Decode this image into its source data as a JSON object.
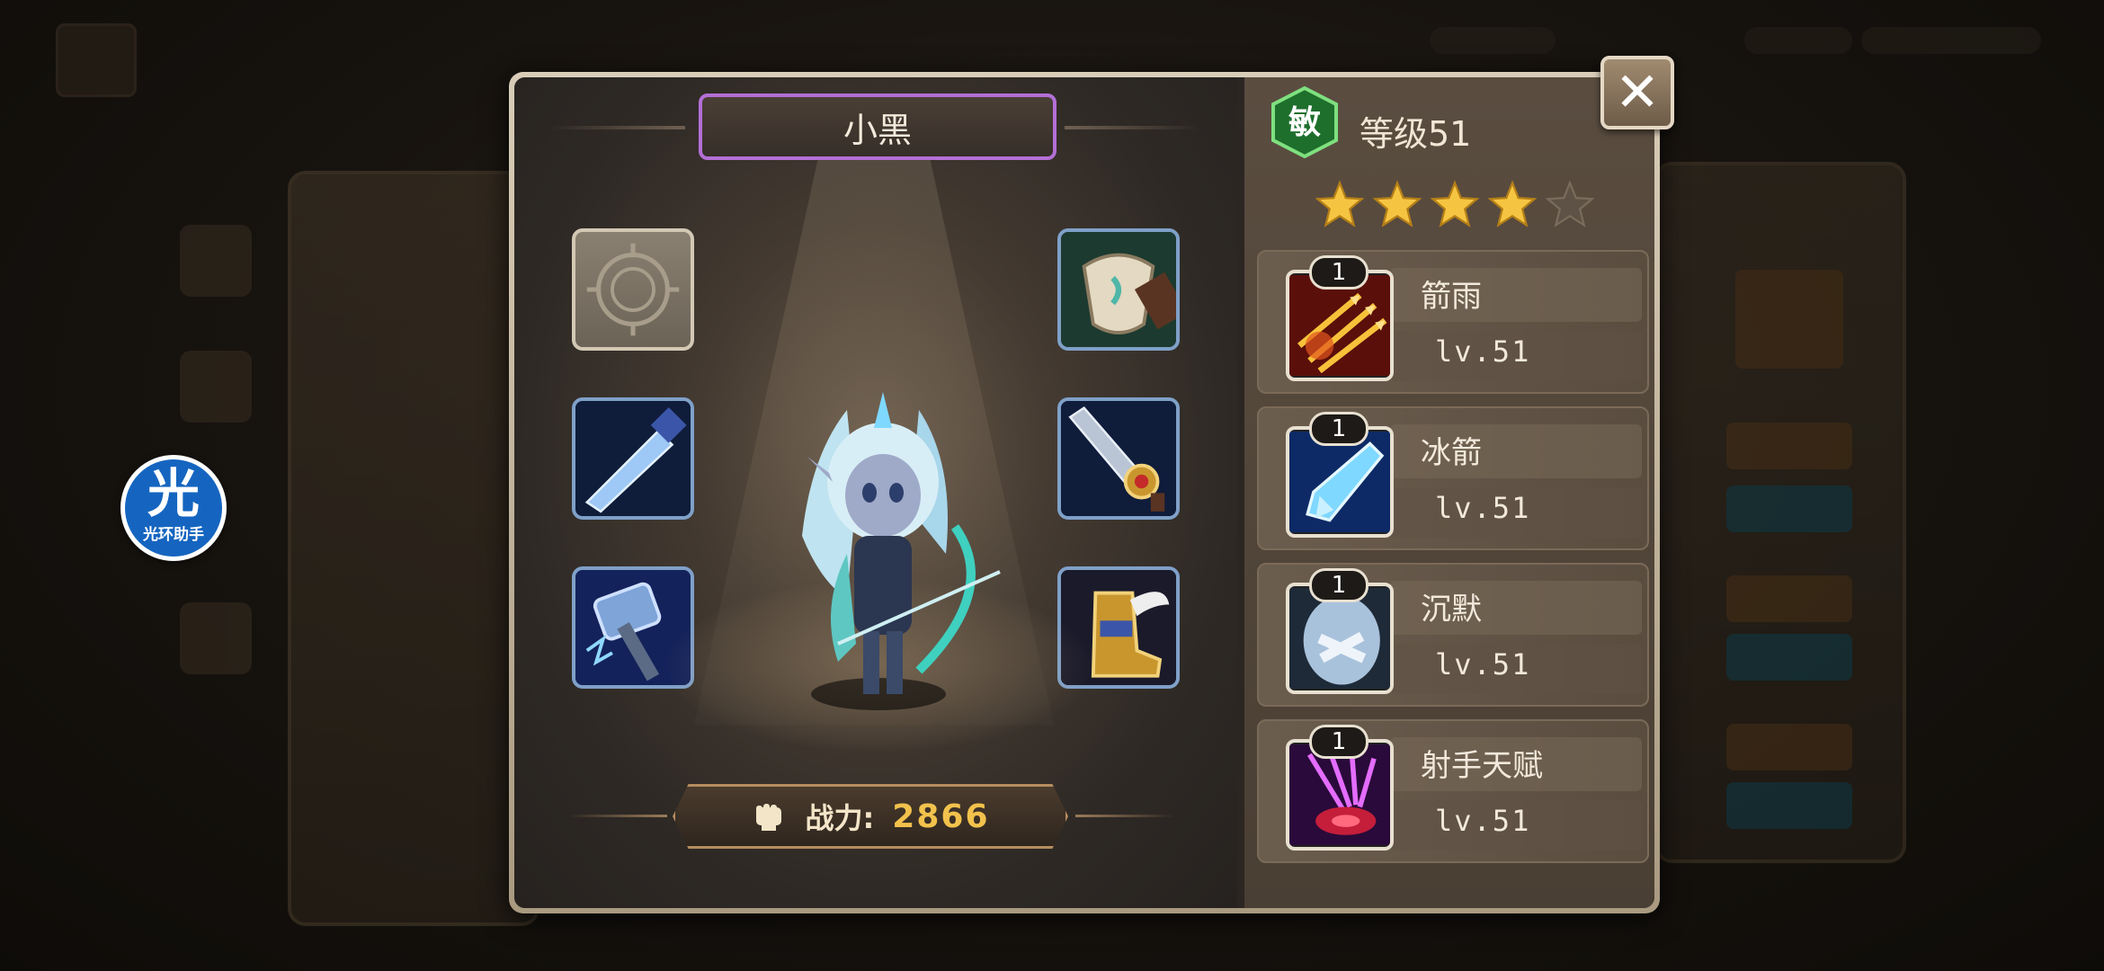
{
  "hero": {
    "name": "小黑",
    "class_glyph": "敏",
    "level_text": "等级51",
    "stars_filled": 4,
    "stars_total": 5,
    "power_label": "战力:",
    "power_value": "2866"
  },
  "helper": {
    "glyph": "光",
    "label": "光环助手"
  },
  "equipment": [
    {
      "slot": "top-left",
      "icon": "empty-slot-icon"
    },
    {
      "slot": "top-right",
      "icon": "shield-icon"
    },
    {
      "slot": "mid-left",
      "icon": "sword-icon"
    },
    {
      "slot": "mid-right",
      "icon": "greatsword-icon"
    },
    {
      "slot": "bottom-left",
      "icon": "hammer-icon"
    },
    {
      "slot": "bottom-right",
      "icon": "winged-boot-icon"
    }
  ],
  "skills": [
    {
      "name": "箭雨",
      "badge": "1",
      "level": "lv.51",
      "icon": "arrow-rain-icon"
    },
    {
      "name": "冰箭",
      "badge": "1",
      "level": "lv.51",
      "icon": "ice-arrow-icon"
    },
    {
      "name": "沉默",
      "badge": "1",
      "level": "lv.51",
      "icon": "silence-icon"
    },
    {
      "name": "射手天赋",
      "badge": "1",
      "level": "lv.51",
      "icon": "archer-talent-icon"
    }
  ],
  "close_label": "✕",
  "colors": {
    "name_border": "#b36fd6",
    "power_value": "#f2c24c",
    "class_badge": "#2e8b3a",
    "star": "#f5c542"
  }
}
